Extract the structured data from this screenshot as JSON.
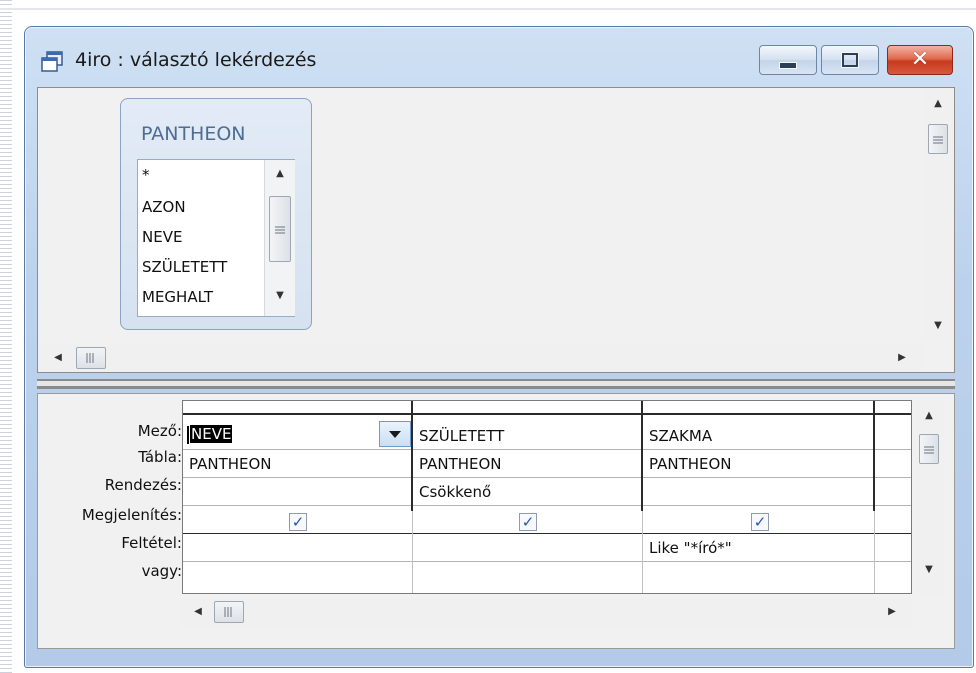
{
  "window": {
    "title": "4iro : választó lekérdezés",
    "close_glyph": "✕"
  },
  "colors": {
    "frame": "#bcd2ec",
    "pane_bg": "#f1f1f1",
    "table_title": "#4f6c93",
    "close_button": "#c8391d",
    "check": "#2a55a5"
  },
  "table": {
    "name": "PANTHEON",
    "fields": [
      "*",
      "AZON",
      "NEVE",
      "SZÜLETETT",
      "MEGHALT"
    ]
  },
  "grid": {
    "row_labels": {
      "field": "Mező:",
      "table": "Tábla:",
      "sort": "Rendezés:",
      "show": "Megjelenítés:",
      "criteria": "Feltétel:",
      "or": "vagy:"
    },
    "columns": [
      {
        "field": "NEVE",
        "table": "PANTHEON",
        "sort": "",
        "show": true,
        "criteria": "",
        "or": ""
      },
      {
        "field": "SZÜLETETT",
        "table": "PANTHEON",
        "sort": "Csökkenő",
        "show": true,
        "criteria": "",
        "or": ""
      },
      {
        "field": "SZAKMA",
        "table": "PANTHEON",
        "sort": "",
        "show": true,
        "criteria": "Like \"*író*\"",
        "or": ""
      }
    ],
    "check_glyph": "✓"
  },
  "icons": {
    "title": "window-stack-icon",
    "dropdown": "chevron-down-icon",
    "scroll_up": "▲",
    "scroll_down": "▼",
    "scroll_left": "◀",
    "scroll_right": "▶"
  }
}
